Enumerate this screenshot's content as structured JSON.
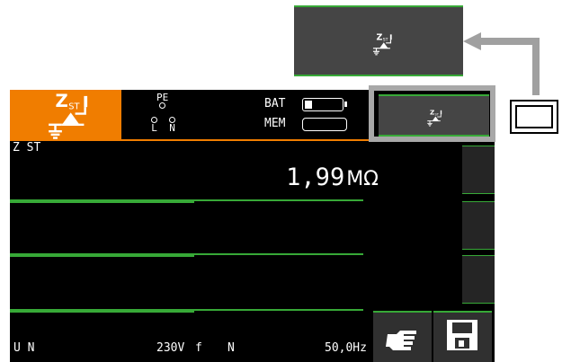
{
  "colors": {
    "accent_orange": "#f07d00",
    "softkey_green": "#37a937",
    "softkey_gray": "#454545",
    "screen_bg": "#000000",
    "callout_gray": "#a8a8a8"
  },
  "mode_icon": {
    "z_label": "Z",
    "sub_label": "ST",
    "icon_name": "zst-mode-icon"
  },
  "connections": {
    "pe": "PE",
    "l": "L",
    "n": "N"
  },
  "status": {
    "bat_label": "BAT",
    "mem_label": "MEM",
    "battery_level": 0.2
  },
  "measurement": {
    "name": "Z ST",
    "value": "1,99",
    "unit": "MΩ"
  },
  "footer": {
    "un_label": "U N",
    "voltage": "230V",
    "f_label": "f",
    "n_label": "N",
    "frequency": "50,0Hz"
  },
  "softkeys": {
    "top": "zst-softkey",
    "hand": "pointing-hand-icon",
    "save": "floppy-disk-icon"
  }
}
